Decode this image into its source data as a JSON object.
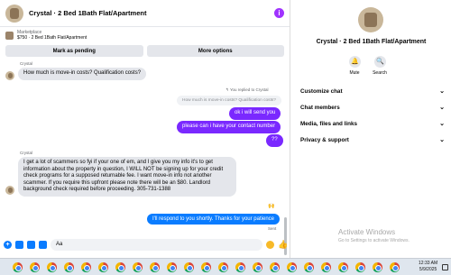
{
  "header": {
    "title": "Crystal · 2 Bed 1Bath Flat/Apartment"
  },
  "listing": {
    "label": "Marketplace",
    "summary": "$750 · 2 Bed 1Bath Flat/Apartment"
  },
  "actions": {
    "mark_pending": "Mark as pending",
    "more_options": "More options"
  },
  "messages": {
    "sender1": "Crystal",
    "msg1": "How much is move-in costs? Qualification costs?",
    "reply_note": "You replied to Crystal",
    "quoted": "How much is move-in costs? Qualification costs?",
    "out1": "ok i will send you",
    "out2": "please can i have your contact number",
    "out3": "??",
    "sender2": "Crystal",
    "msg2_l1": "I get a lot of scammers so fyi if your one of em, and I give you my info it's to get",
    "msg2_l2": "information about the property in question, I WILL NOT be signing up for your credit",
    "msg2_l3": "check programs for a supposed returnable fee.  I want move-in info not another",
    "msg2_l4": "scammer.  If you require this upfront please note there will be an $80. Landlord",
    "msg2_l5": "background check required before proceeding.  305-731-1388",
    "out4": "I'll respond to you shortly. Thanks for your patience",
    "sent": "Sent"
  },
  "composer": {
    "value": "Aa"
  },
  "side": {
    "title": "Crystal · 2 Bed 1Bath Flat/Apartment",
    "mute": "Mute",
    "search": "Search",
    "rows": [
      "Customize chat",
      "Chat members",
      "Media, files and links",
      "Privacy & support"
    ]
  },
  "watermark": {
    "line1": "Activate Windows",
    "line2": "Go to Settings to activate Windows."
  },
  "tray": {
    "time": "12:33 AM",
    "date": "5/9/2025"
  },
  "colors": {
    "accent_purple": "#7a29ff",
    "messenger_blue": "#0a7cff"
  }
}
